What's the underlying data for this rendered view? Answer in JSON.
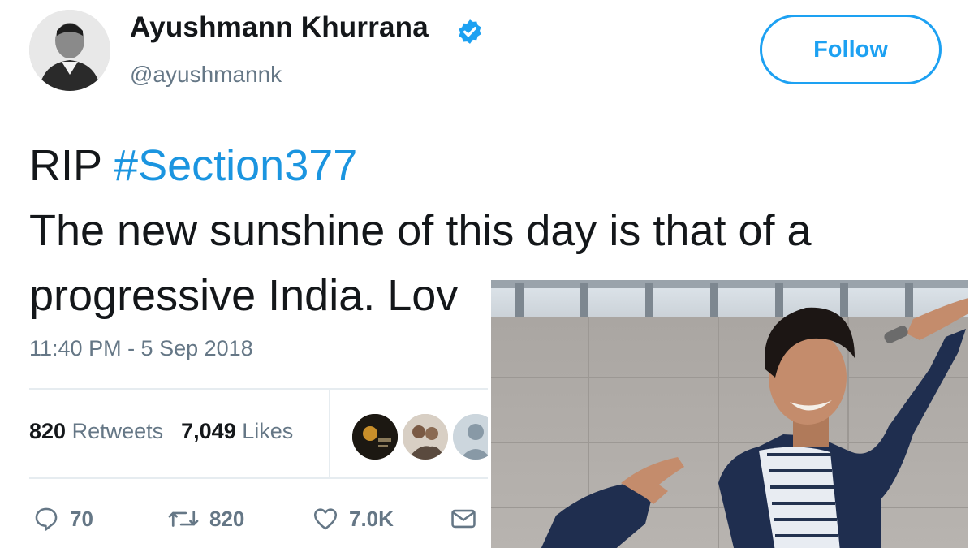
{
  "user": {
    "display_name": "Ayushmann Khurrana",
    "handle": "@ayushmannk",
    "verified": true,
    "avatar_icon": "profile-photo"
  },
  "follow_button": {
    "label": "Follow"
  },
  "tweet": {
    "lines": [
      {
        "prefix": "RIP ",
        "hashtag": "#Section377"
      },
      {
        "text": "The new sunshine of this day is that of a"
      },
      {
        "text": "progressive India. Lov"
      }
    ],
    "timestamp": "11:40 PM - 5 Sep 2018"
  },
  "stats": {
    "retweets_count": "820",
    "retweets_label": "Retweets",
    "likes_count": "7,049",
    "likes_label": "Likes"
  },
  "actions": {
    "reply_count": "70",
    "retweet_count": "820",
    "like_count": "7.0K",
    "reply_icon": "reply-icon",
    "retweet_icon": "retweet-icon",
    "like_icon": "heart-icon",
    "dm_icon": "envelope-icon"
  },
  "colors": {
    "brand_blue": "#1da1f2",
    "hashtag_blue": "#1b95e0",
    "secondary_text": "#657786",
    "primary_text": "#14171a"
  }
}
